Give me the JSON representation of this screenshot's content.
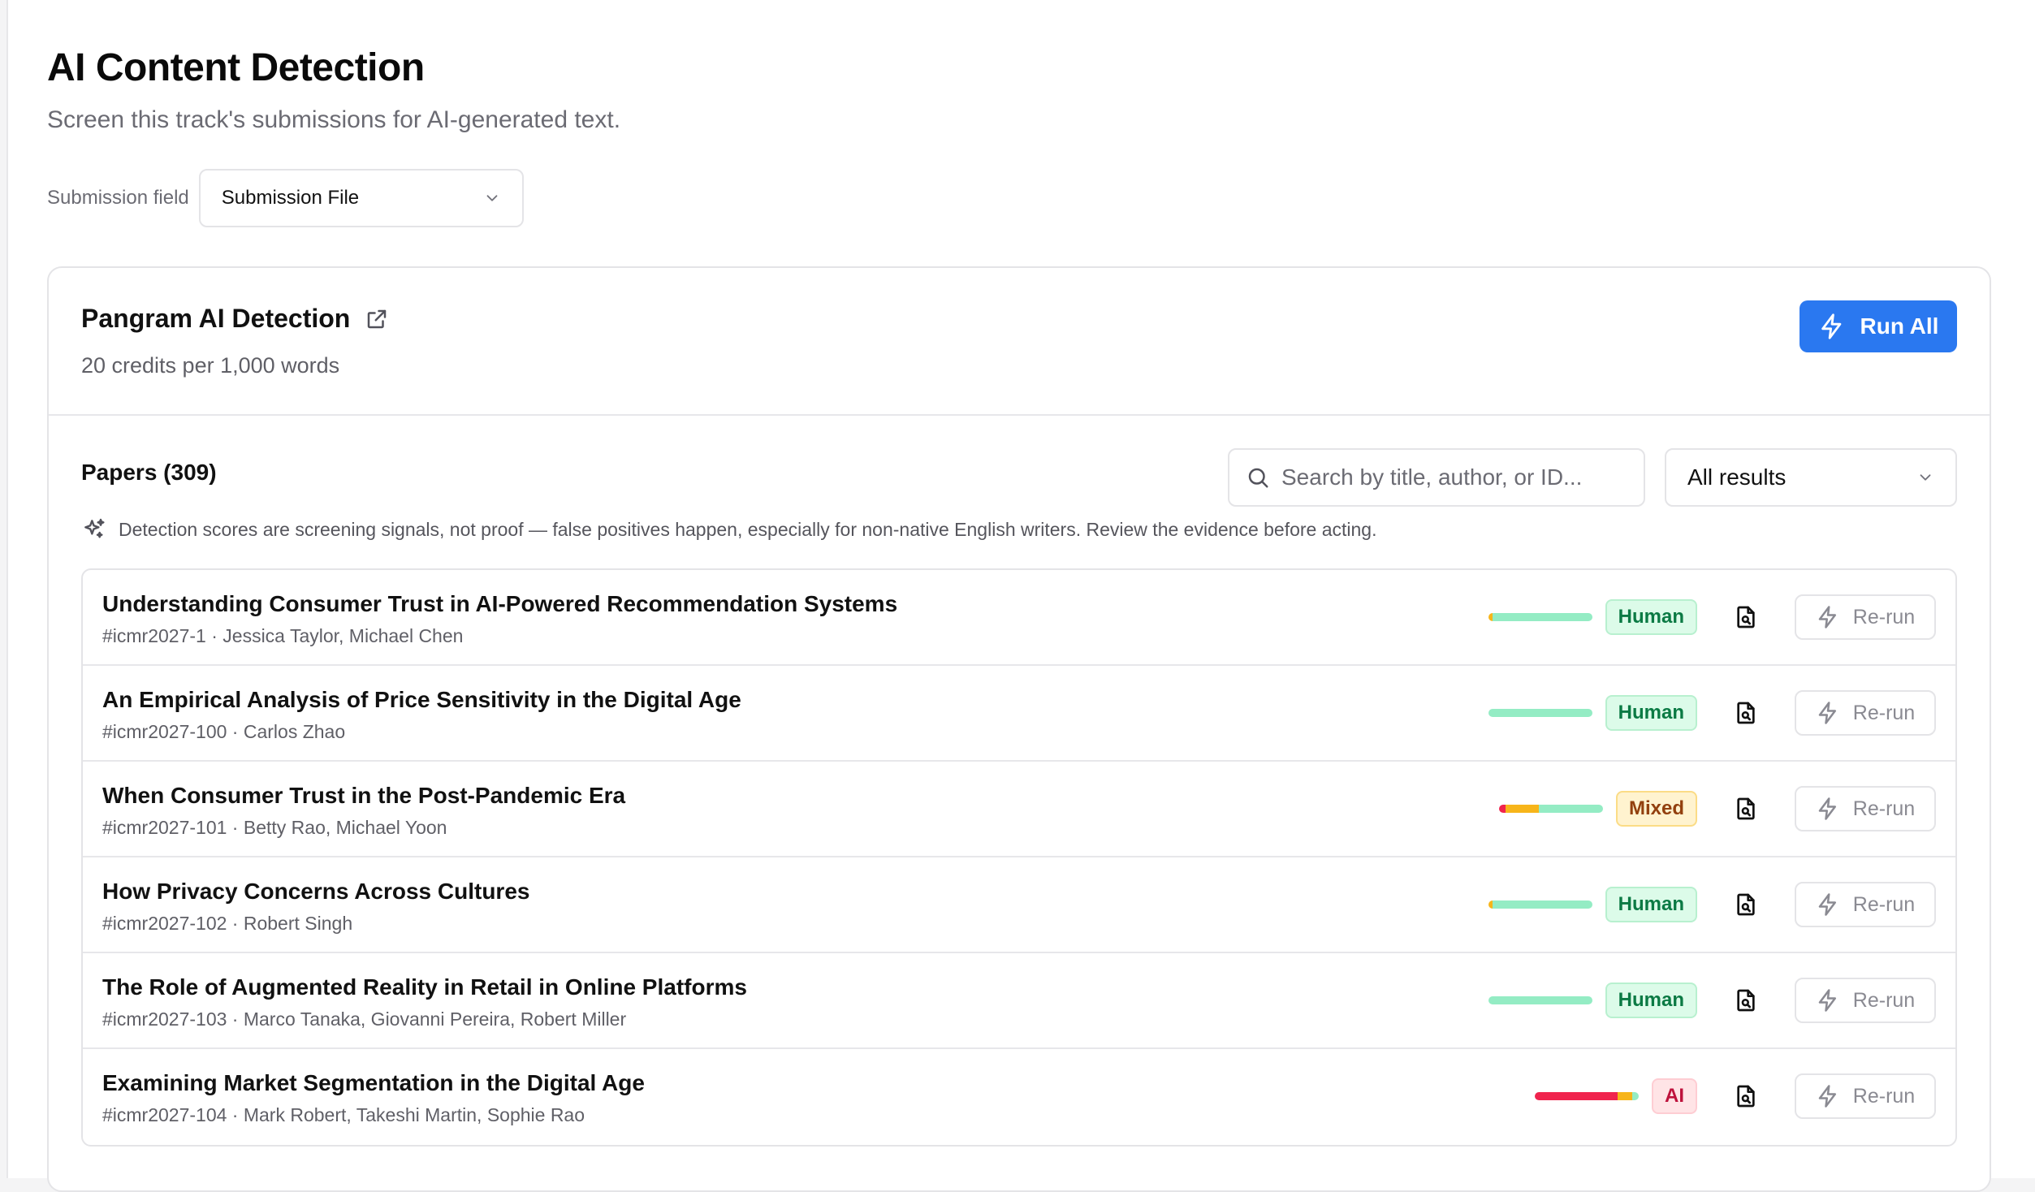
{
  "page": {
    "title": "AI Content Detection",
    "subtitle": "Screen this track's submissions for AI-generated text."
  },
  "submission_field": {
    "label": "Submission field",
    "value": "Submission File"
  },
  "detector": {
    "title": "Pangram AI Detection",
    "subtitle": "20 credits per 1,000 words",
    "run_all_label": "Run All",
    "accent_color": "#2a78f0"
  },
  "papers": {
    "title": "Papers (309)",
    "search_placeholder": "Search by title, author, or ID...",
    "filter_value": "All results",
    "notice": "Detection scores are screening signals, not proof — false positives happen, especially for non-native English writers. Review the evidence before acting.",
    "rerun_label": "Re-run",
    "colors": {
      "ai": "#f0244e",
      "mixed": "#f7b51a",
      "human": "#94ecc4"
    },
    "items": [
      {
        "title": "Understanding Consumer Trust in AI-Powered Recommendation Systems",
        "meta": "#icmr2027-1 · Jessica Taylor, Michael Chen",
        "verdict": "Human",
        "kind": "human",
        "ai": 0.0,
        "mixed": 0.04,
        "human": 0.96
      },
      {
        "title": "An Empirical Analysis of Price Sensitivity in the Digital Age",
        "meta": "#icmr2027-100 · Carlos Zhao",
        "verdict": "Human",
        "kind": "human",
        "ai": 0.0,
        "mixed": 0.0,
        "human": 1.0
      },
      {
        "title": "When Consumer Trust in the Post-Pandemic Era",
        "meta": "#icmr2027-101 · Betty Rao, Michael Yoon",
        "verdict": "Mixed",
        "kind": "mixed",
        "ai": 0.06,
        "mixed": 0.32,
        "human": 0.62
      },
      {
        "title": "How Privacy Concerns Across Cultures",
        "meta": "#icmr2027-102 · Robert Singh",
        "verdict": "Human",
        "kind": "human",
        "ai": 0.0,
        "mixed": 0.04,
        "human": 0.96
      },
      {
        "title": "The Role of Augmented Reality in Retail in Online Platforms",
        "meta": "#icmr2027-103 · Marco Tanaka, Giovanni Pereira, Robert Miller",
        "verdict": "Human",
        "kind": "human",
        "ai": 0.0,
        "mixed": 0.0,
        "human": 1.0
      },
      {
        "title": "Examining Market Segmentation in the Digital Age",
        "meta": "#icmr2027-104 · Mark Robert, Takeshi Martin, Sophie Rao",
        "verdict": "AI",
        "kind": "ai",
        "ai": 0.8,
        "mixed": 0.14,
        "human": 0.06
      }
    ]
  }
}
